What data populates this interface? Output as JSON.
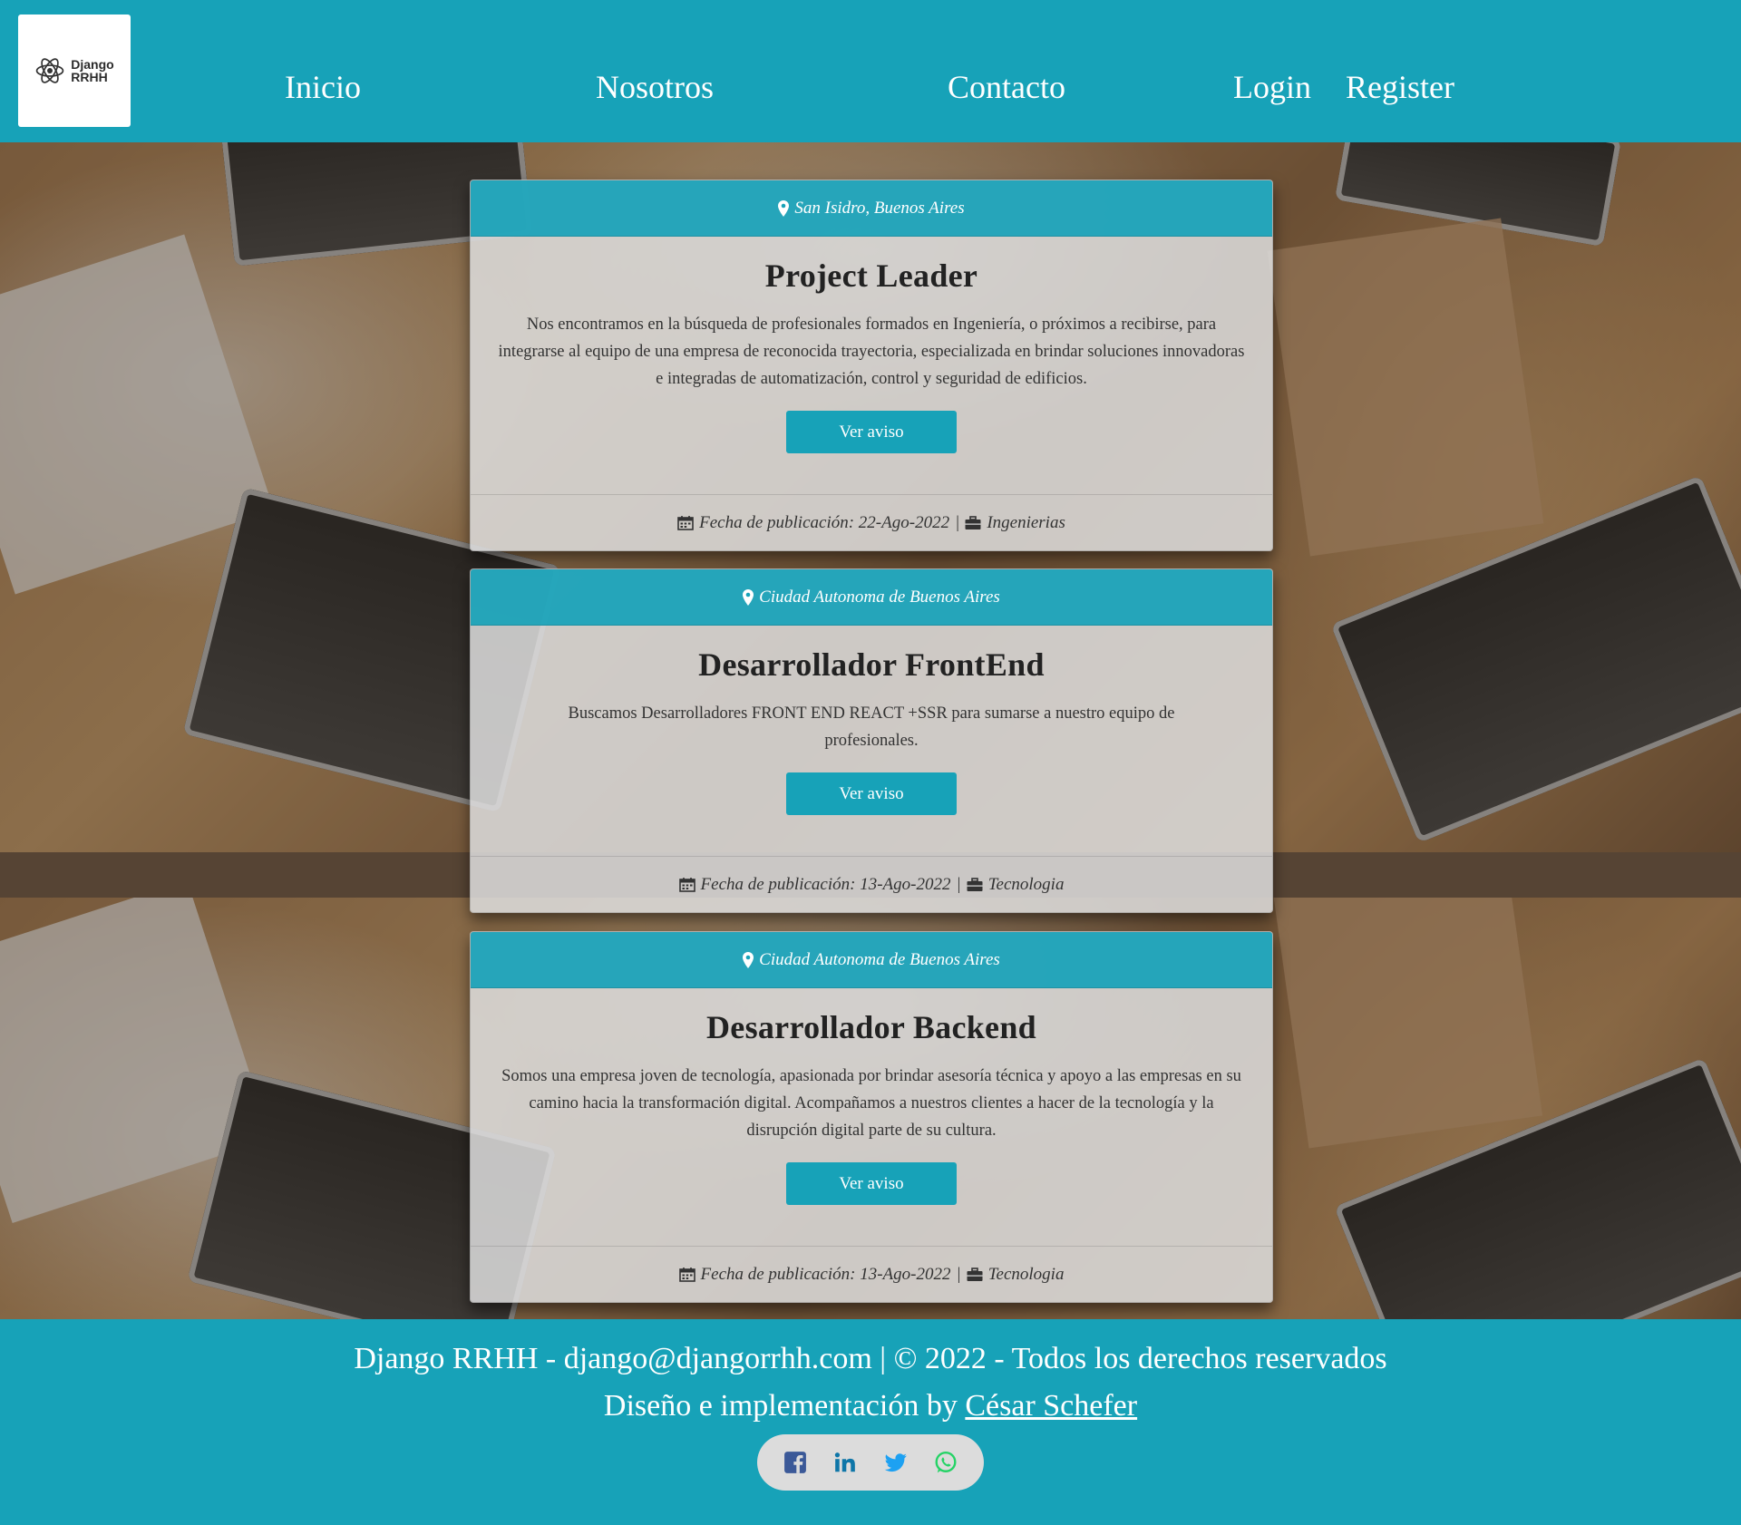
{
  "brand": {
    "logo_line1": "Django",
    "logo_line2": "RRHH"
  },
  "nav": {
    "items": [
      {
        "label": "Inicio"
      },
      {
        "label": "Nosotros"
      },
      {
        "label": "Contacto"
      },
      {
        "label": "Login"
      },
      {
        "label": "Register"
      }
    ]
  },
  "jobs": [
    {
      "location": "San Isidro, Buenos Aires",
      "title": "Project Leader",
      "description": "Nos encontramos en la búsqueda de profesionales formados en Ingeniería, o próximos a recibirse, para integrarse al equipo de una empresa de reconocida trayectoria, especializada en brindar soluciones innovadoras e integradas de automatización, control y seguridad de edificios.",
      "button": "Ver aviso",
      "date": "Fecha de publicación: 22-Ago-2022",
      "separator": "|",
      "category": "Ingenierias"
    },
    {
      "location": "Ciudad Autonoma de Buenos Aires",
      "title": "Desarrollador FrontEnd",
      "description": "Buscamos Desarrolladores FRONT END REACT +SSR para sumarse a nuestro equipo de profesionales.",
      "button": "Ver aviso",
      "date": "Fecha de publicación: 13-Ago-2022",
      "separator": "|",
      "category": "Tecnologia"
    },
    {
      "location": "Ciudad Autonoma de Buenos Aires",
      "title": "Desarrollador Backend",
      "description": "Somos una empresa joven de tecnología, apasionada por brindar asesoría técnica y apoyo a las empresas en su camino hacia la transformación digital. Acompañamos a nuestros clientes a hacer de la tecnología y la disrupción digital parte de su cultura.",
      "button": "Ver aviso",
      "date": "Fecha de publicación: 13-Ago-2022",
      "separator": "|",
      "category": "Tecnologia"
    }
  ],
  "footer": {
    "line1": "Django RRHH - django@djangorrhh.com | © 2022 - Todos los derechos reservados",
    "line2_prefix": "Diseño e implementación by ",
    "author_link": "César Schefer",
    "social": [
      {
        "icon": "facebook-icon",
        "color": "#3b5998"
      },
      {
        "icon": "linkedin-icon",
        "color": "#0e76a8"
      },
      {
        "icon": "twitter-icon",
        "color": "#1da1f2"
      },
      {
        "icon": "whatsapp-icon",
        "color": "#25d366"
      }
    ]
  },
  "colors": {
    "primary": "#17a2b8",
    "card_bg": "#dddddd",
    "text_dark": "#222222"
  }
}
